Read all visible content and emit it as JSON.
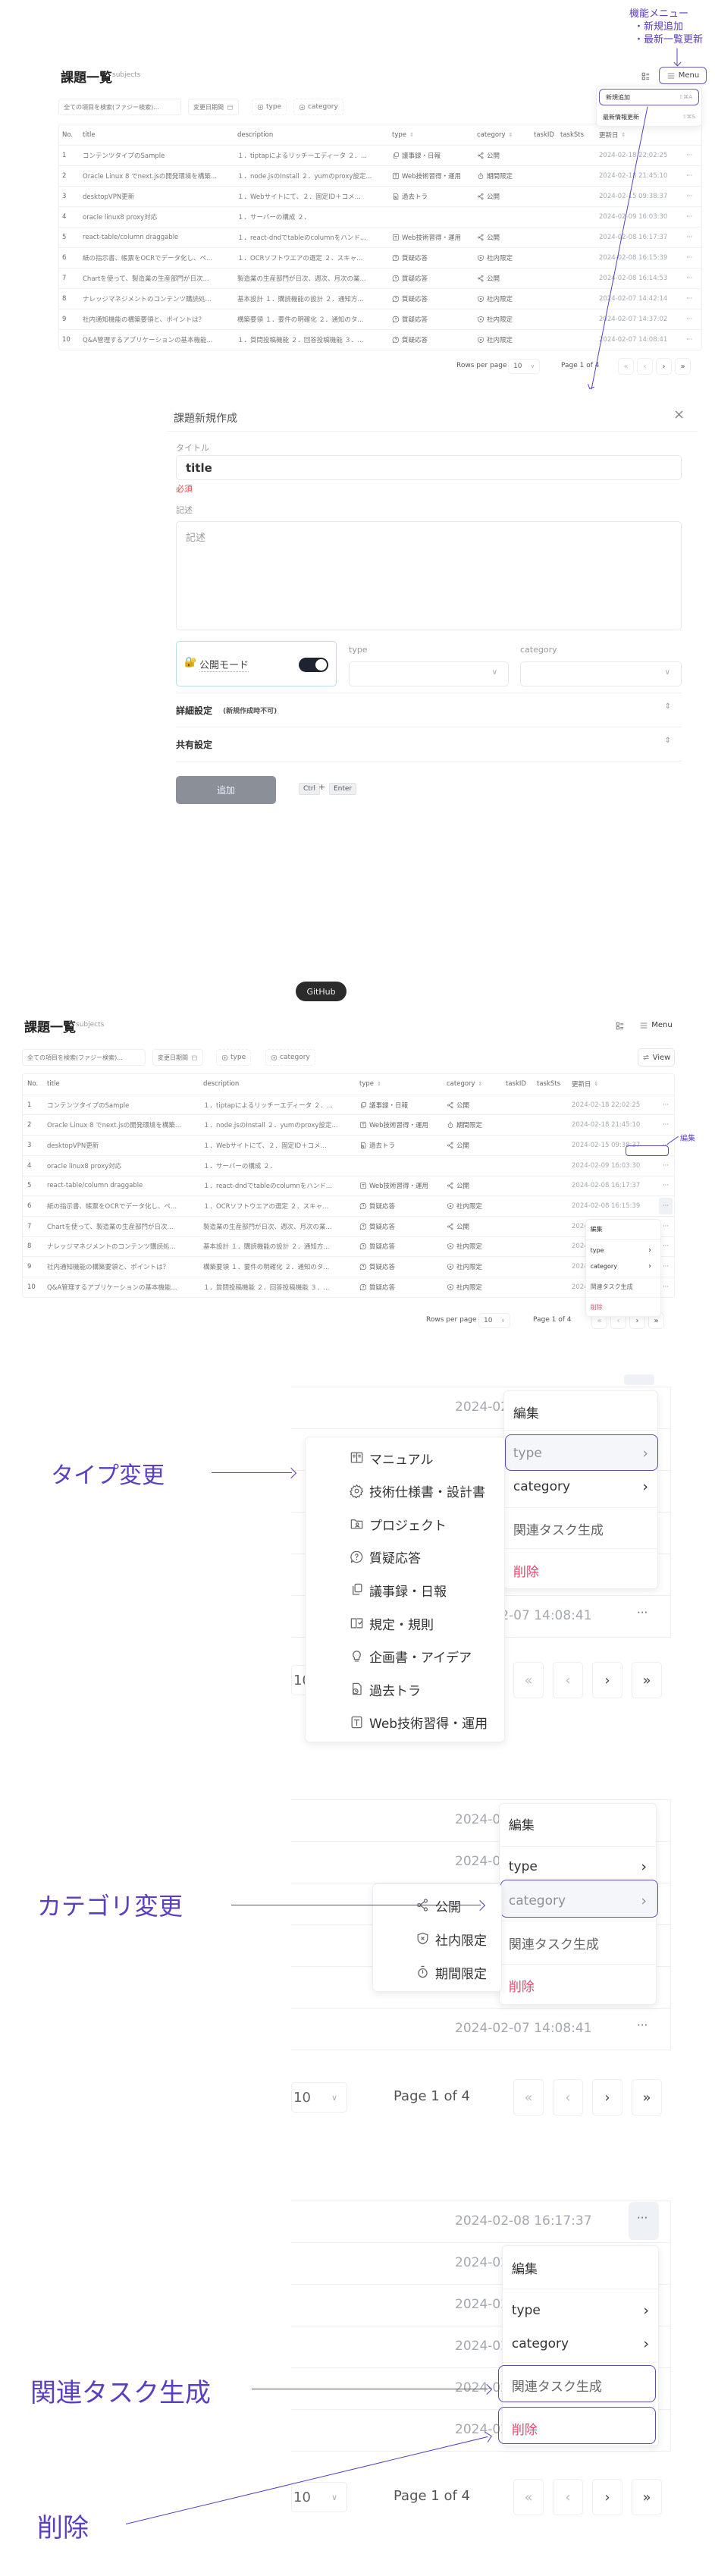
{
  "annotations": {
    "menu_lines": [
      "機能メニュー",
      "・新規追加",
      "・最新一覧更新"
    ],
    "edit": "編集",
    "type_change": "タイプ変更",
    "category_change": "カテゴリ変更",
    "related_task": "関連タスク生成",
    "delete": "削除",
    "color": "#5a3fc0"
  },
  "github_badge": "GitHub",
  "header": {
    "title": "課題一覧",
    "subtitle": "subjects",
    "menu_label": "Menu",
    "view_label": "View"
  },
  "menu_dropdown": [
    {
      "label": "新規追加",
      "shortcut": "⇧⌘A"
    },
    {
      "label": "最新情報更新",
      "shortcut": "⇧⌘S"
    }
  ],
  "filters": {
    "search_placeholder": "全ての項目を検索(ファジー検索)...",
    "date_range": "変更日期間",
    "type": "type",
    "category": "category"
  },
  "table": {
    "columns": [
      "No.",
      "title",
      "description",
      "type",
      "category",
      "taskID",
      "taskSts",
      "更新日"
    ],
    "sortable": [
      false,
      false,
      false,
      true,
      true,
      false,
      false,
      true
    ],
    "rows": [
      {
        "no": "1",
        "title": "コンテンツタイプのSample",
        "description": "１．tiptapによるリッチーエディータ ２．...",
        "type": "議事録・日報",
        "type_icon": "copy",
        "category": "公開",
        "category_icon": "share",
        "updated": "2024-02-18 22:02:25"
      },
      {
        "no": "2",
        "title": "Oracle Linux 8 でnext.jsの開発環境を構築...",
        "description": "１．node.jsのInstall ２．yumのproxy設定...",
        "type": "Web技術習得・運用",
        "type_icon": "text-box",
        "category": "期間限定",
        "category_icon": "timer",
        "updated": "2024-02-18 21:45:10"
      },
      {
        "no": "3",
        "title": "desktopVPN更新",
        "description": "１．Webサイトにて、２．固定ID＋コメ...",
        "type": "過去トラ",
        "type_icon": "file-clock",
        "category": "公開",
        "category_icon": "share",
        "updated": "2024-02-15 09:38:37"
      },
      {
        "no": "4",
        "title": "oracle linux8 proxy対応",
        "description": "１．サーバーの構成 ２．",
        "type": "",
        "type_icon": "",
        "category": "",
        "category_icon": "",
        "updated": "2024-02-09 16:03:30"
      },
      {
        "no": "5",
        "title": "react-table/column draggable",
        "description": "１．react-dndでtableのcolumnをハンド...",
        "type": "Web技術習得・運用",
        "type_icon": "text-box",
        "category": "公開",
        "category_icon": "share",
        "updated": "2024-02-08 16:17:37"
      },
      {
        "no": "6",
        "title": "紙の指示書、帳票をOCRでデータ化し、ペ...",
        "description": "１．OCRソフトウエアの選定 ２．スキャ...",
        "type": "質疑応答",
        "type_icon": "message-question",
        "category": "社内限定",
        "category_icon": "shield-x",
        "updated": "2024-02-08 16:15:39"
      },
      {
        "no": "7",
        "title": "Chartを使って、製造業の生産部門が日次...",
        "description": "製造業の生産部門が日次、週次、月次の業...",
        "type": "質疑応答",
        "type_icon": "message-question",
        "category": "公開",
        "category_icon": "share",
        "updated": "2024-02-08 16:14:53"
      },
      {
        "no": "8",
        "title": "ナレッジマネジメントのコンテンツ購読処...",
        "description": "基本設計 １．購読機能の設計 ２．通知方...",
        "type": "質疑応答",
        "type_icon": "message-question",
        "category": "社内限定",
        "category_icon": "shield-x",
        "updated": "2024-02-07 14:42:14"
      },
      {
        "no": "9",
        "title": "社内通知機能の構築要領と、ポイントは？",
        "description": "構築要領 １．要件の明確化 ２．通知のタ...",
        "type": "質疑応答",
        "type_icon": "message-question",
        "category": "社内限定",
        "category_icon": "shield-x",
        "updated": "2024-02-07 14:37:02"
      },
      {
        "no": "10",
        "title": "Q&A管理するアプリケーションの基本機能...",
        "description": "１．質問投稿機能 ２．回答投稿機能 ３．...",
        "type": "質疑応答",
        "type_icon": "message-question",
        "category": "社内限定",
        "category_icon": "shield-x",
        "updated": "2024-02-07 14:08:41"
      }
    ],
    "row_action": "···"
  },
  "pagination": {
    "rows_per_page_label": "Rows per page",
    "rows_per_page": "10",
    "page_text": "Page 1 of 4",
    "first": "«",
    "prev": "‹",
    "next": "›",
    "last": "»"
  },
  "row_menu": {
    "edit": "編集",
    "type": "type",
    "category": "category",
    "related_task": "関連タスク生成",
    "delete": "削除",
    "chevron": "›"
  },
  "type_options": [
    {
      "label": "マニュアル",
      "icon": "book"
    },
    {
      "label": "技術仕様書・設計書",
      "icon": "gear"
    },
    {
      "label": "プロジェクト",
      "icon": "folder-user"
    },
    {
      "label": "質疑応答",
      "icon": "message-question"
    },
    {
      "label": "議事録・日報",
      "icon": "copy"
    },
    {
      "label": "規定・規則",
      "icon": "book-check"
    },
    {
      "label": "企画書・アイデア",
      "icon": "bulb"
    },
    {
      "label": "過去トラ",
      "icon": "file-clock"
    },
    {
      "label": "Web技術習得・運用",
      "icon": "text-box"
    }
  ],
  "category_options": [
    {
      "label": "公開",
      "icon": "share"
    },
    {
      "label": "社内限定",
      "icon": "shield-x"
    },
    {
      "label": "期間限定",
      "icon": "timer"
    }
  ],
  "modal": {
    "title": "課題新規作成",
    "close": "×",
    "title_label": "タイトル",
    "title_value": "title",
    "required": "必須",
    "description_label": "記述",
    "description_placeholder": "記述",
    "public_mode_icon": "🔐",
    "public_mode_label": "公開モード",
    "public_mode_on": true,
    "type_label": "type",
    "category_label": "category",
    "detail_settings": "詳細設定",
    "detail_settings_note": "(新規作成時不可)",
    "share_settings": "共有設定",
    "submit": "追加",
    "shortcut_keys": [
      "Ctrl",
      "+",
      "Enter"
    ]
  },
  "colors": {
    "accent": "#5a3fc0",
    "delete": "#e8476d",
    "required": "#e0474c",
    "submit_bg": "#8b9098",
    "toggle": "#1d2330"
  }
}
